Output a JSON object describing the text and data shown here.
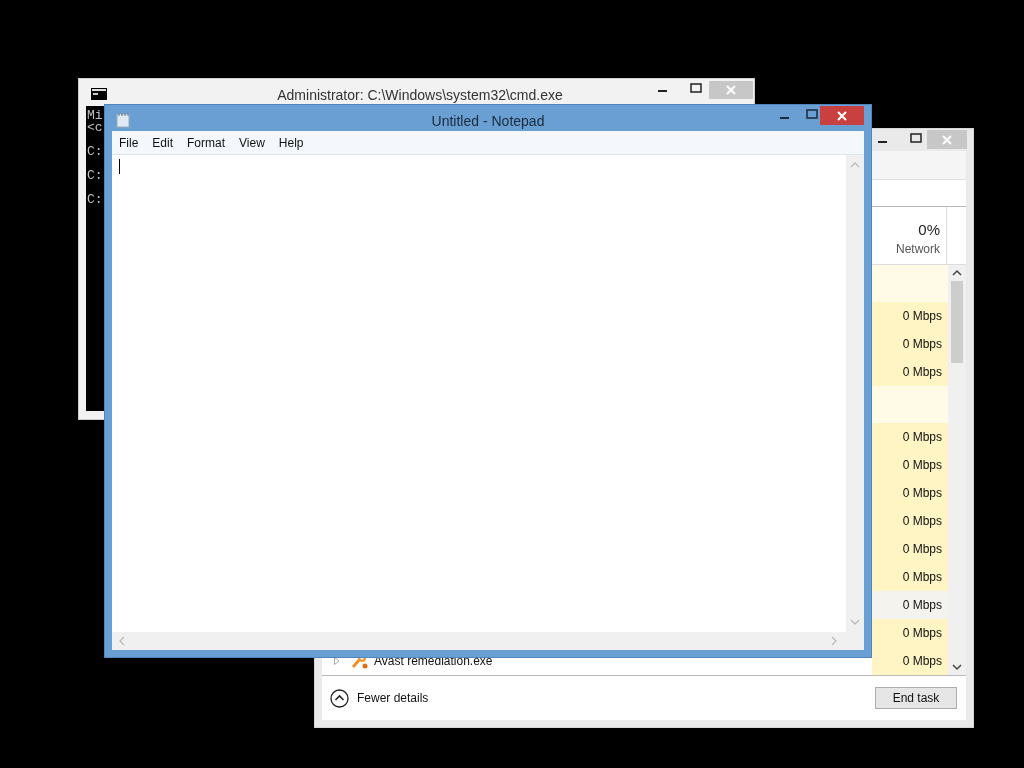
{
  "cmd_window": {
    "title": "Administrator: C:\\Windows\\system32\\cmd.exe",
    "blocks": [
      [
        "Mi",
        "<c"
      ],
      [
        "C:"
      ],
      [
        "C:"
      ],
      [
        "C:"
      ]
    ]
  },
  "task_manager": {
    "network_header": {
      "percent": "0%",
      "label": "Network"
    },
    "rows": [
      {
        "kind": "group"
      },
      {
        "kind": "process",
        "network": "0 Mbps",
        "selected": false
      },
      {
        "kind": "process",
        "network": "0 Mbps",
        "selected": false
      },
      {
        "kind": "process",
        "network": "0 Mbps",
        "selected": false
      },
      {
        "kind": "group"
      },
      {
        "kind": "process",
        "network": "0 Mbps",
        "selected": false
      },
      {
        "kind": "process",
        "network": "0 Mbps",
        "selected": false
      },
      {
        "kind": "process",
        "network": "0 Mbps",
        "selected": false
      },
      {
        "kind": "process",
        "network": "0 Mbps",
        "selected": false
      },
      {
        "kind": "process",
        "network": "0 Mbps",
        "selected": false
      },
      {
        "kind": "process",
        "network": "0 Mbps",
        "selected": false
      },
      {
        "kind": "process",
        "network": "0 Mbps",
        "selected": true
      },
      {
        "kind": "process",
        "network": "0 Mbps",
        "selected": false
      },
      {
        "kind": "process",
        "name": "Avast remediation.exe",
        "network": "0 Mbps",
        "selected": false
      }
    ],
    "footer": {
      "toggle": "Fewer details",
      "button": "End task"
    }
  },
  "notepad": {
    "title": "Untitled - Notepad",
    "menu": [
      "File",
      "Edit",
      "Format",
      "View",
      "Help"
    ]
  }
}
